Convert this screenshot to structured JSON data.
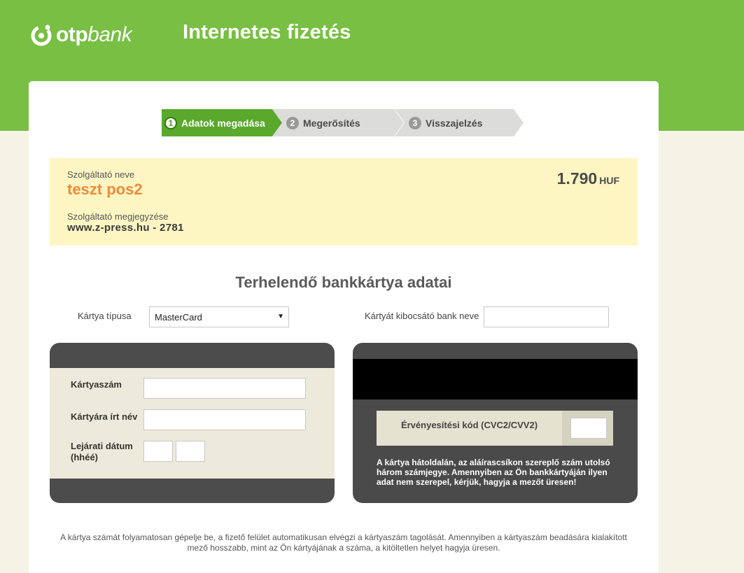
{
  "header": {
    "logo_bold": "otp",
    "logo_light": "bank",
    "title": "Internetes fizetés"
  },
  "steps": [
    {
      "num": "1",
      "label": "Adatok megadása"
    },
    {
      "num": "2",
      "label": "Megerősítés"
    },
    {
      "num": "3",
      "label": "Visszajelzés"
    }
  ],
  "merchant": {
    "name_label": "Szolgáltató neve",
    "name": "teszt pos2",
    "note_label": "Szolgáltató megjegyzése",
    "note": "www.z-press.hu - 2781",
    "amount": "1.790",
    "currency": "HUF"
  },
  "form": {
    "section_title": "Terhelendő bankkártya adatai",
    "card_type_label": "Kártya típusa",
    "card_type_value": "MasterCard",
    "issuer_label": "Kártyát kibocsátó bank neve",
    "card_number_label": "Kártyaszám",
    "name_on_card_label": "Kártyára írt név",
    "expiry_label_line1": "Lejárati dátum",
    "expiry_label_line2": "(hhéé)",
    "cvc_label": "Érvényesítési kód (CVC2/CVV2)",
    "cvc_note": "A kártya hátoldalán, az aláírascsíkon szereplő szám utolsó három számjegye. Amennyiben az Ön bankkártyáján ilyen adat nem szerepel, kérjük, hagyja a mezőt üresen!"
  },
  "footer_note": "A kártya számát folyamatosan gépelje be, a fizető felület automatikusan elvégzi a kártyaszám tagolását. Amennyiben a kártyaszám beadására kialakított mező hosszabb, mint az Ön kártyájának a száma, a kitöltetlen helyet hagyja üresen.",
  "colors": {
    "brand_green": "#78bf43",
    "step_active": "#5aa82c",
    "merchant_orange": "#f08a3a",
    "info_bg": "#fdf6c3"
  }
}
